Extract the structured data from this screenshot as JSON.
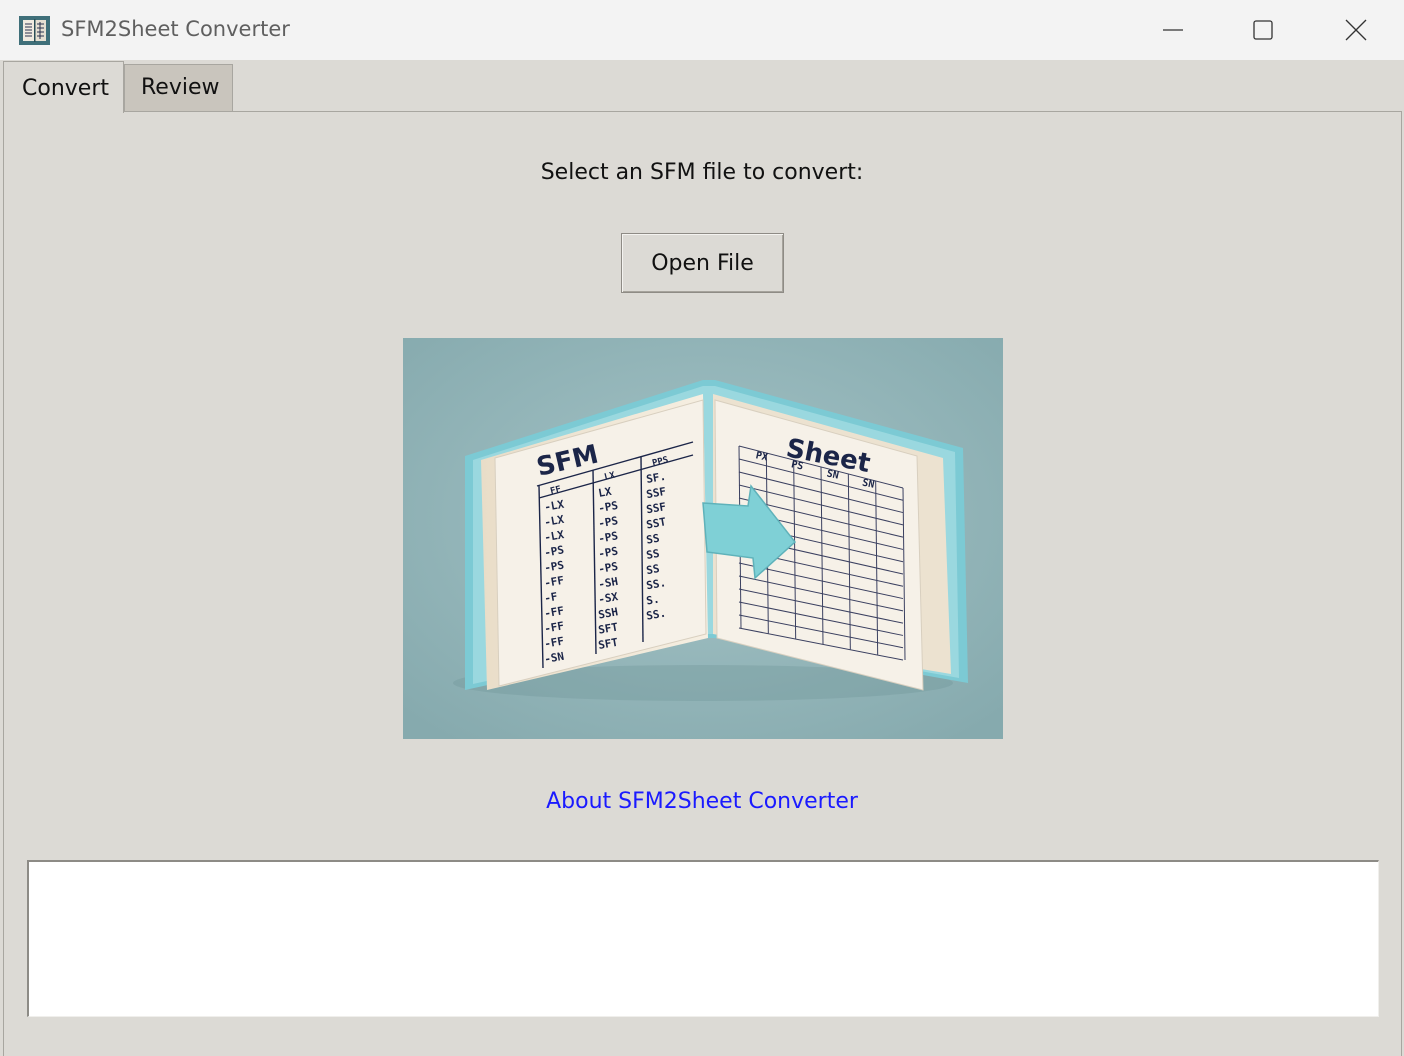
{
  "window": {
    "title": "SFM2Sheet Converter",
    "icon": "app-book-icon"
  },
  "controls": {
    "minimize": "minimize-icon",
    "maximize": "maximize-icon",
    "close": "close-icon"
  },
  "tabs": [
    {
      "label": "Convert",
      "selected": true
    },
    {
      "label": "Review",
      "selected": false
    }
  ],
  "convert": {
    "prompt": "Select an SFM file to convert:",
    "open_button": "Open File",
    "illustration": {
      "left_title": "SFM",
      "right_title": "Sheet",
      "left_headers": [
        "FF",
        "LX",
        "PPS"
      ],
      "left_rows": [
        [
          "-LX",
          "LX",
          "SF."
        ],
        [
          "-LX",
          "-PS",
          "SSF"
        ],
        [
          "-LX",
          "-PS",
          "SSF"
        ],
        [
          "-PS",
          "-PS",
          "SST"
        ],
        [
          "-PS",
          "-PS",
          "SS"
        ],
        [
          "-FF",
          "-PS",
          "SS"
        ],
        [
          "-F",
          "-SH",
          "SS"
        ],
        [
          "-FF",
          "-SX",
          "SS."
        ],
        [
          "-FF",
          "SSH",
          "S."
        ],
        [
          "-FF",
          "SFT",
          "SS."
        ],
        [
          "-SN",
          "SFT",
          ""
        ]
      ],
      "right_headers": [
        "PX",
        "PS",
        "SN",
        "SN"
      ],
      "colors": {
        "background": "#8fb3b7",
        "book_edge": "#7ccad4",
        "page": "#f4efe6",
        "arrow": "#7fd0d6",
        "ink": "#1b2548"
      }
    },
    "about_link": "About SFM2Sheet Converter",
    "output_text": ""
  }
}
